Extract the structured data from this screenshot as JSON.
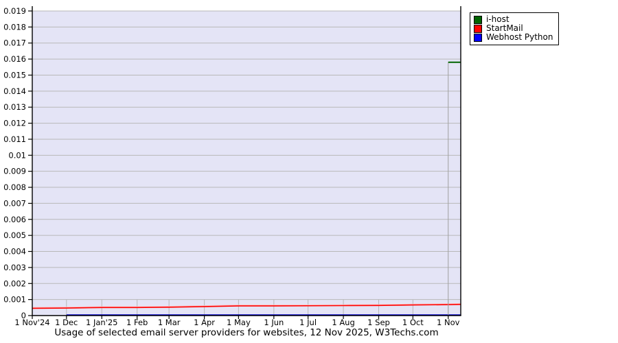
{
  "chart_data": {
    "type": "line",
    "title": "Usage of selected email server providers for websites, 12 Nov 2025, W3Techs.com",
    "xlabel": "",
    "ylabel": "",
    "ylim": [
      0,
      0.019
    ],
    "ytick_values": [
      0.019,
      0.018,
      0.017,
      0.016,
      0.015,
      0.014,
      0.013,
      0.012,
      0.011,
      0.01,
      0.009,
      0.008,
      0.007,
      0.006,
      0.005,
      0.004,
      0.003,
      0.002,
      0.001,
      0
    ],
    "ytick_labels": [
      "0.019",
      "0.018",
      "0.017",
      "0.016",
      "0.015",
      "0.014",
      "0.013",
      "0.012",
      "0.011",
      "0.01",
      "0.009",
      "0.008",
      "0.007",
      "0.006",
      "0.005",
      "0.004",
      "0.003",
      "0.002",
      "0.001",
      "0"
    ],
    "xtick_labels": [
      "1 Nov'24",
      "1 Dec",
      "1 Jan'25",
      "1 Feb",
      "1 Mar",
      "1 Apr",
      "1 May",
      "1 Jun",
      "1 Jul",
      "1 Aug",
      "1 Sep",
      "1 Oct",
      "1 Nov"
    ],
    "xtick_day_offsets": [
      0,
      30,
      61,
      92,
      120,
      151,
      181,
      212,
      242,
      273,
      304,
      334,
      365
    ],
    "x_total_days": 376,
    "grid": {
      "horizontal": true,
      "vertical_bottom_band_only": true
    },
    "legend": {
      "position": "top-right",
      "entries": [
        {
          "label": "i-host",
          "color": "#006400"
        },
        {
          "label": "StartMail",
          "color": "#ff0000"
        },
        {
          "label": "Webhost Python",
          "color": "#0000ff"
        }
      ]
    },
    "series": [
      {
        "name": "Webhost Python",
        "color": "#0000cc",
        "points": [
          [
            30,
            4e-05
          ],
          [
            61,
            4e-05
          ],
          [
            92,
            4e-05
          ],
          [
            120,
            4e-05
          ],
          [
            151,
            4e-05
          ],
          [
            181,
            4e-05
          ],
          [
            212,
            4e-05
          ],
          [
            242,
            4e-05
          ],
          [
            273,
            4e-05
          ],
          [
            304,
            4e-05
          ],
          [
            334,
            4e-05
          ],
          [
            365,
            4e-05
          ],
          [
            376,
            4e-05
          ]
        ]
      },
      {
        "name": "StartMail",
        "color": "#ff0000",
        "points": [
          [
            0,
            0.00045
          ],
          [
            30,
            0.00047
          ],
          [
            61,
            0.0005
          ],
          [
            92,
            0.0005
          ],
          [
            120,
            0.00052
          ],
          [
            151,
            0.00056
          ],
          [
            181,
            0.0006
          ],
          [
            212,
            0.0006
          ],
          [
            242,
            0.00061
          ],
          [
            273,
            0.00062
          ],
          [
            304,
            0.00063
          ],
          [
            334,
            0.00066
          ],
          [
            365,
            0.00068
          ],
          [
            376,
            0.0007
          ]
        ]
      },
      {
        "name": "i-host",
        "color": "#006400",
        "points": [
          [
            365,
            0.0158
          ],
          [
            376,
            0.0158
          ]
        ],
        "drop_line_at_start": true
      }
    ],
    "colors": {
      "plot_bg": "#e4e4f6",
      "grid": "#b8b8b8",
      "axis": "#000000",
      "drop_line": "#a0a0a0",
      "red_halo": "#ffbbbb"
    }
  }
}
